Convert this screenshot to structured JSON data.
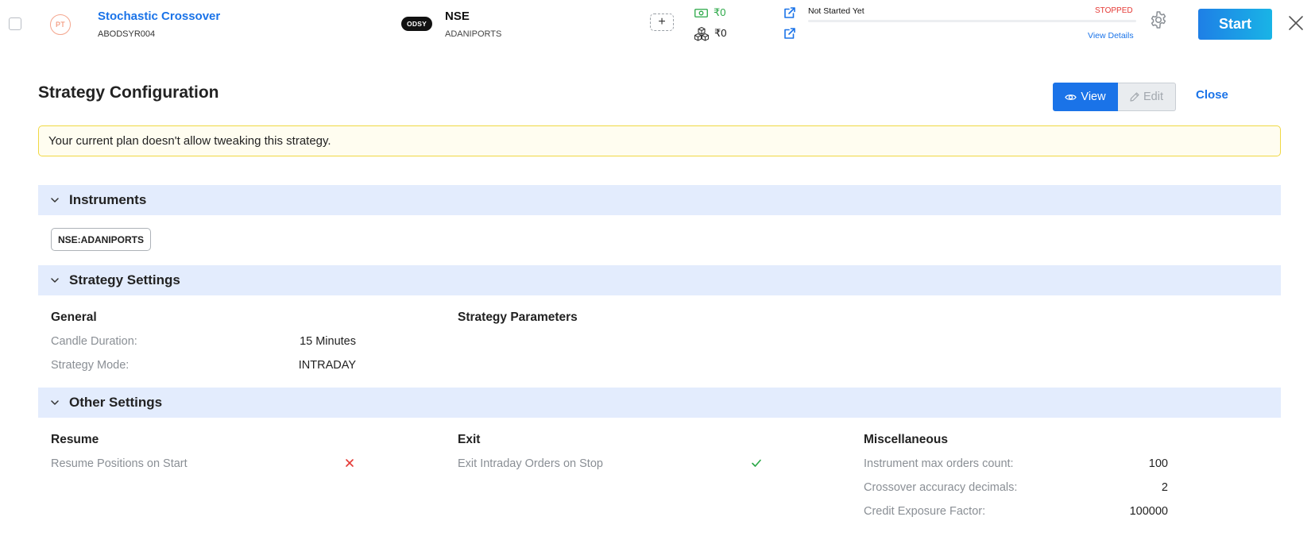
{
  "strategy": {
    "avatar": "PT",
    "name": "Stochastic Crossover",
    "code": "ABODSYR004"
  },
  "broker": {
    "badge": "ODSY",
    "exchange": "NSE",
    "symbol": "ADANIPORTS"
  },
  "pnl": {
    "cash_value": "₹0",
    "holdings_value": "₹0"
  },
  "status": {
    "text": "Not Started Yet",
    "badge": "STOPPED",
    "progress_percent": 0,
    "view_details": "View Details"
  },
  "actions": {
    "start_label": "Start"
  },
  "config": {
    "title": "Strategy Configuration",
    "view_label": "View",
    "edit_label": "Edit",
    "close_label": "Close",
    "alert": "Your current plan doesn't allow tweaking this strategy."
  },
  "instruments": {
    "header": "Instruments",
    "items": [
      "NSE:ADANIPORTS"
    ]
  },
  "strategy_settings": {
    "header": "Strategy Settings",
    "general_title": "General",
    "parameters_title": "Strategy Parameters",
    "rows": [
      {
        "label": "Candle Duration:",
        "value": "15 Minutes"
      },
      {
        "label": "Strategy Mode:",
        "value": "INTRADAY"
      }
    ]
  },
  "other_settings": {
    "header": "Other Settings",
    "resume": {
      "title": "Resume",
      "label": "Resume Positions on Start",
      "enabled": false
    },
    "exit": {
      "title": "Exit",
      "label": "Exit Intraday Orders on Stop",
      "enabled": true
    },
    "misc": {
      "title": "Miscellaneous",
      "rows": [
        {
          "label": "Instrument max orders count:",
          "value": "100"
        },
        {
          "label": "Crossover accuracy decimals:",
          "value": "2"
        },
        {
          "label": "Credit Exposure Factor:",
          "value": "100000"
        }
      ]
    }
  },
  "colors": {
    "primary": "#1a73e8",
    "success": "#28a745",
    "danger": "#e53935",
    "section_bg": "#e3ecfd",
    "alert_border": "#f0d843"
  }
}
